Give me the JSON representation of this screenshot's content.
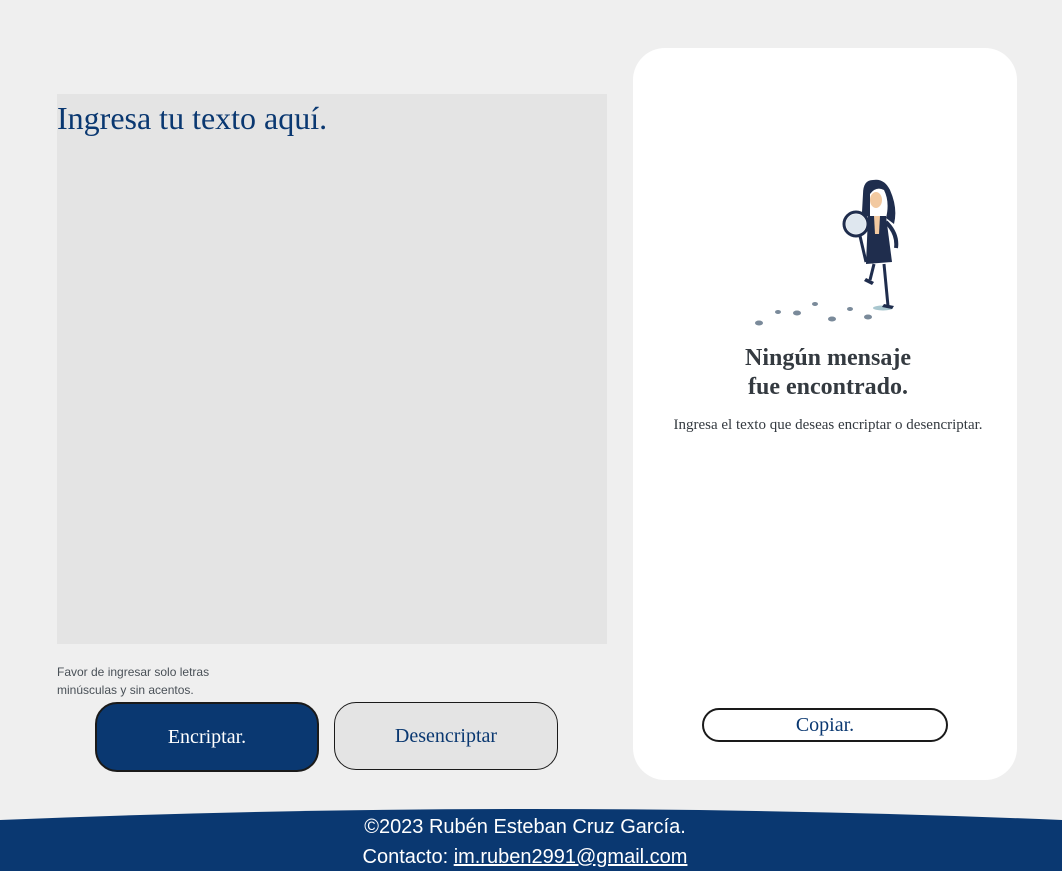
{
  "input": {
    "placeholder": "Ingresa tu texto aquí."
  },
  "hint": {
    "text": "Favor de ingresar solo letras minúsculas y sin acentos."
  },
  "actions": {
    "encrypt_label": "Encriptar.",
    "decrypt_label": "Desencriptar"
  },
  "output": {
    "illustration_icon": "detective-girl-magnifier-icon",
    "empty_title_line1": "Ningún mensaje",
    "empty_title_line2": "fue encontrado.",
    "empty_subtitle": "Ingresa el texto que deseas encriptar o desencriptar.",
    "copy_label": "Copiar."
  },
  "footer": {
    "copyright": "©2023 Rubén Esteban Cruz García.",
    "contact_label": "Contacto: ",
    "contact_email": "im.ruben2991@gmail.com"
  },
  "colors": {
    "primary": "#0a3871",
    "background": "#efefef",
    "textarea_bg": "#e4e4e4",
    "panel_bg": "#ffffff"
  }
}
